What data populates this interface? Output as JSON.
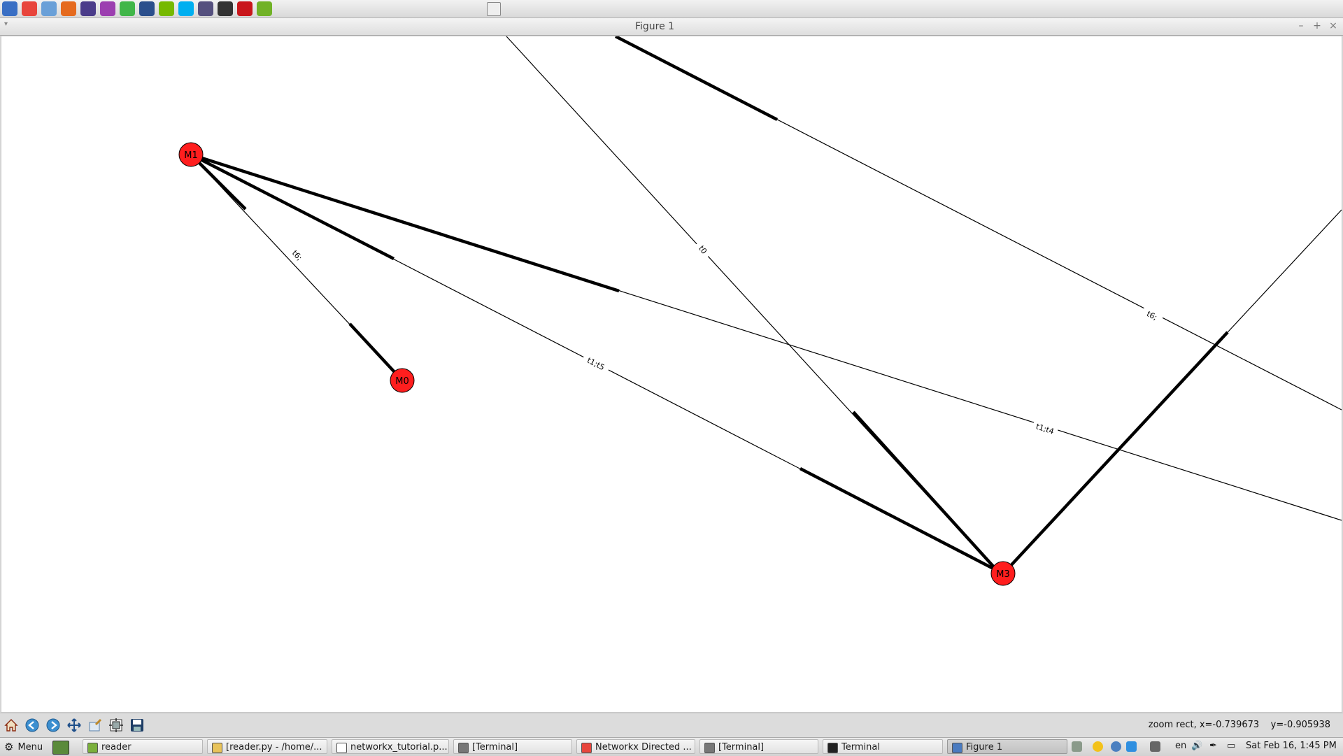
{
  "window": {
    "title": "Figure 1",
    "minimize": "–",
    "maximize": "+",
    "close": "×",
    "menu_arrow": "▾"
  },
  "top_launchers": [
    {
      "name": "desktop-icon",
      "color": "#3a6fc4"
    },
    {
      "name": "chrome-icon",
      "color": "#e8453c"
    },
    {
      "name": "cube-icon",
      "color": "#6aa0d8"
    },
    {
      "name": "firefox-icon",
      "color": "#e56a1e"
    },
    {
      "name": "eclipse-icon",
      "color": "#4b3c8a"
    },
    {
      "name": "apps-icon",
      "color": "#9c3fb0"
    },
    {
      "name": "qt-icon",
      "color": "#41b649"
    },
    {
      "name": "globe-icon",
      "color": "#2b4f8c"
    },
    {
      "name": "nvidia-icon",
      "color": "#76b900"
    },
    {
      "name": "skype-icon",
      "color": "#00aff0"
    },
    {
      "name": "vm-icon",
      "color": "#55507e"
    },
    {
      "name": "home-icon",
      "color": "#333333"
    },
    {
      "name": "filezilla-icon",
      "color": "#c9161b"
    },
    {
      "name": "cursor-icon",
      "color": "#71b227"
    }
  ],
  "figure": {
    "nodes": [
      {
        "id": "M1",
        "label": "M1"
      },
      {
        "id": "M0",
        "label": "M0"
      },
      {
        "id": "M3",
        "label": "M3"
      }
    ],
    "edge_labels": [
      "t6;",
      "t1;t5",
      "t0",
      "t1;t4",
      "t6;"
    ]
  },
  "toolbar": {
    "buttons": [
      "home-icon",
      "back-icon",
      "forward-icon",
      "pan-icon",
      "zoom-icon",
      "subplots-icon",
      "save-icon"
    ],
    "status": "zoom rect, x=-0.739673    y=-0.905938"
  },
  "taskbar": {
    "menu_label": "Menu",
    "tasks": [
      {
        "label": "reader",
        "icon": "folder-icon",
        "color": "#7bb03c"
      },
      {
        "label": "[reader.py - /home/...",
        "icon": "editor-icon",
        "color": "#e8c35a"
      },
      {
        "label": "networkx_tutorial.p...",
        "icon": "document-icon",
        "color": "#ffffff"
      },
      {
        "label": "[Terminal]",
        "icon": "terminal-icon",
        "color": "#777777"
      },
      {
        "label": "Networkx Directed ...",
        "icon": "chrome-icon",
        "color": "#e8453c"
      },
      {
        "label": "[Terminal]",
        "icon": "terminal-icon",
        "color": "#777777"
      },
      {
        "label": "Terminal",
        "icon": "terminal-icon",
        "color": "#222222"
      },
      {
        "label": "Figure 1",
        "icon": "window-icon",
        "color": "#4a7bc0"
      }
    ],
    "lang": "en",
    "clock": "Sat Feb 16,  1:45 PM"
  }
}
